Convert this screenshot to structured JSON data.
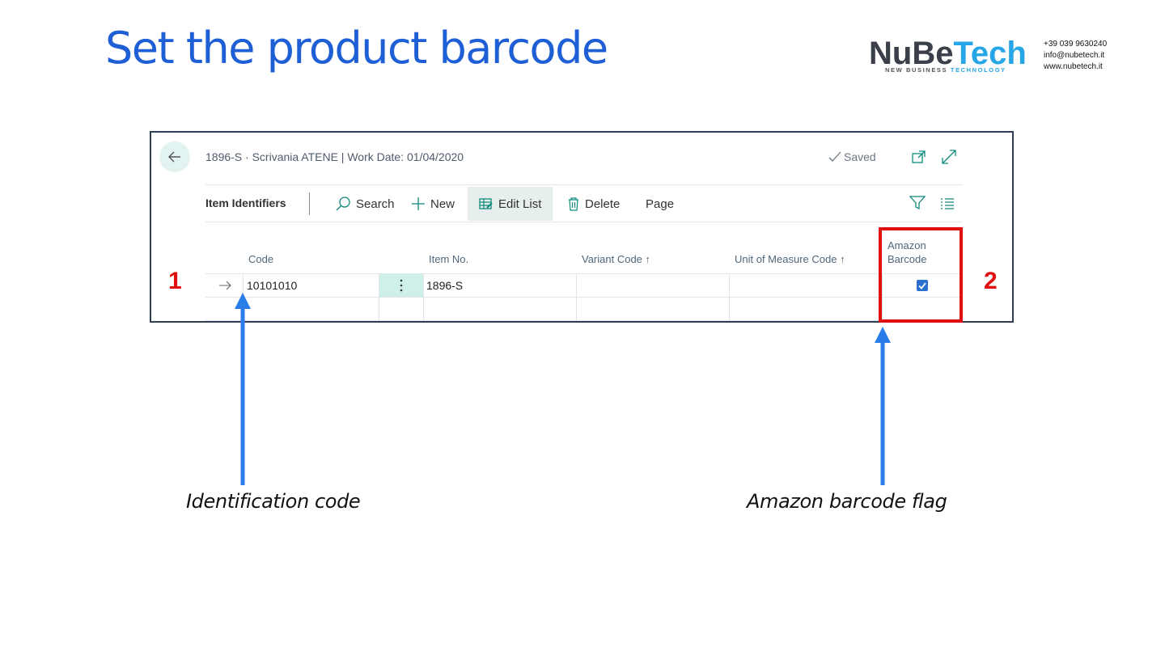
{
  "slide": {
    "title": "Set the product barcode",
    "logo": {
      "dark": "NuBe",
      "blue": "Tech",
      "tagline_dark": "NEW BUSINESS ",
      "tagline_blue": "TECHNOLOGY"
    },
    "contacts": [
      "+39 039 9630240",
      "info@nubetech.it",
      "www.nubetech.it"
    ],
    "callout_1": "1",
    "callout_2": "2",
    "caption_left": "Identification code",
    "caption_right": "Amazon barcode flag"
  },
  "page": {
    "header_title": "1896-S · Scrivania ATENE | Work Date: 01/04/2020",
    "saved_label": "Saved",
    "toolbar": {
      "title": "Item Identifiers",
      "search": "Search",
      "new": "New",
      "edit_list": "Edit List",
      "delete": "Delete",
      "page": "Page"
    },
    "columns": {
      "code": "Code",
      "item_no": "Item No.",
      "variant_code": "Variant Code ↑",
      "uom_code": "Unit of Measure Code ↑",
      "amazon_barcode_line1": "Amazon",
      "amazon_barcode_line2": "Barcode"
    },
    "rows": [
      {
        "code": "10101010",
        "item_no": "1896-S",
        "variant_code": "",
        "uom_code": "",
        "amazon_barcode": true
      }
    ]
  },
  "colors": {
    "accent_teal": "#0e8a7a",
    "title_blue": "#1f5fd6",
    "callout_red": "#e01010",
    "arrow_blue": "#2a7de9"
  }
}
